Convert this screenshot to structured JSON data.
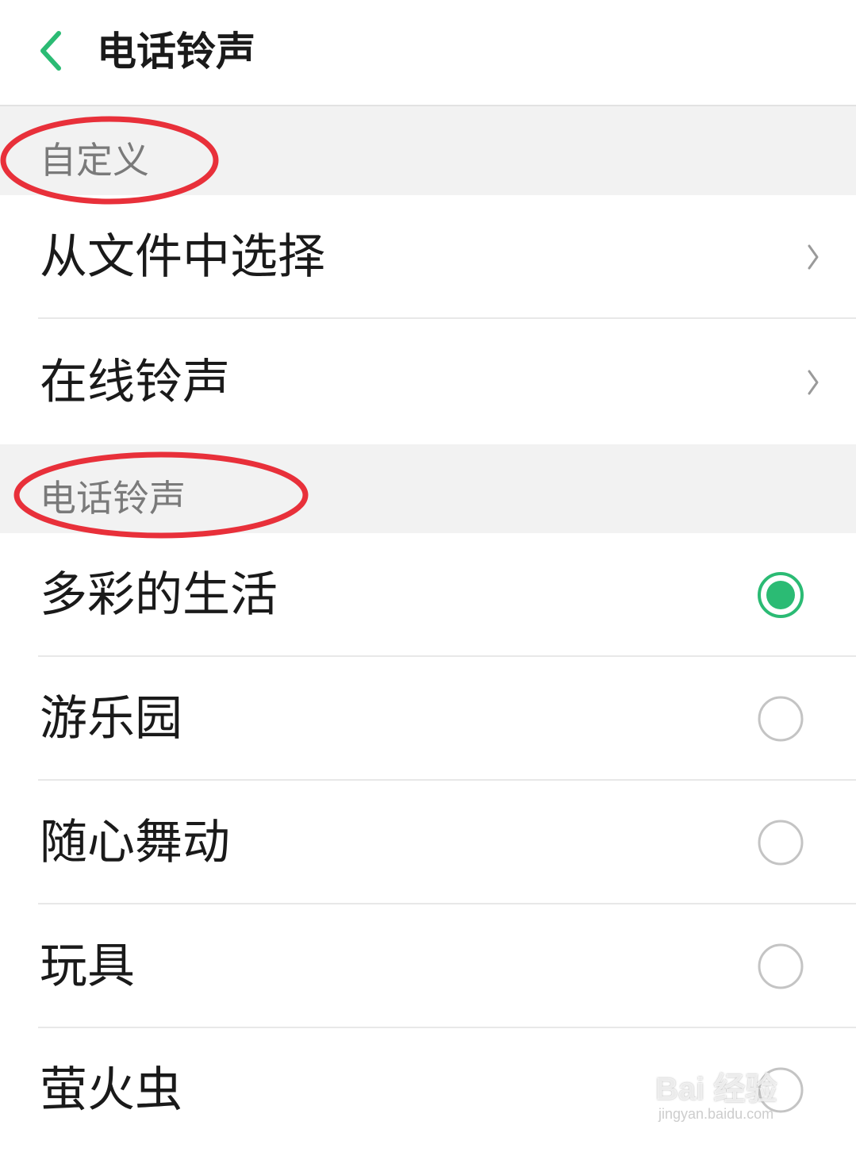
{
  "header": {
    "title": "电话铃声",
    "back_icon": "chevron-left-icon",
    "accent": "#2bbb74"
  },
  "sections": [
    {
      "label": "自定义",
      "items": [
        {
          "label": "从文件中选择",
          "trailing": "chevron-right-icon"
        },
        {
          "label": "在线铃声",
          "trailing": "chevron-right-icon"
        }
      ]
    },
    {
      "label": "电话铃声",
      "items": [
        {
          "label": "多彩的生活",
          "selected": true
        },
        {
          "label": "游乐园",
          "selected": false
        },
        {
          "label": "随心舞动",
          "selected": false
        },
        {
          "label": "玩具",
          "selected": false
        },
        {
          "label": "萤火虫",
          "selected": false
        }
      ]
    }
  ],
  "annotation_color": "#e8303a",
  "watermark": {
    "brand": "Bai 经验",
    "url": "jingyan.baidu.com"
  }
}
